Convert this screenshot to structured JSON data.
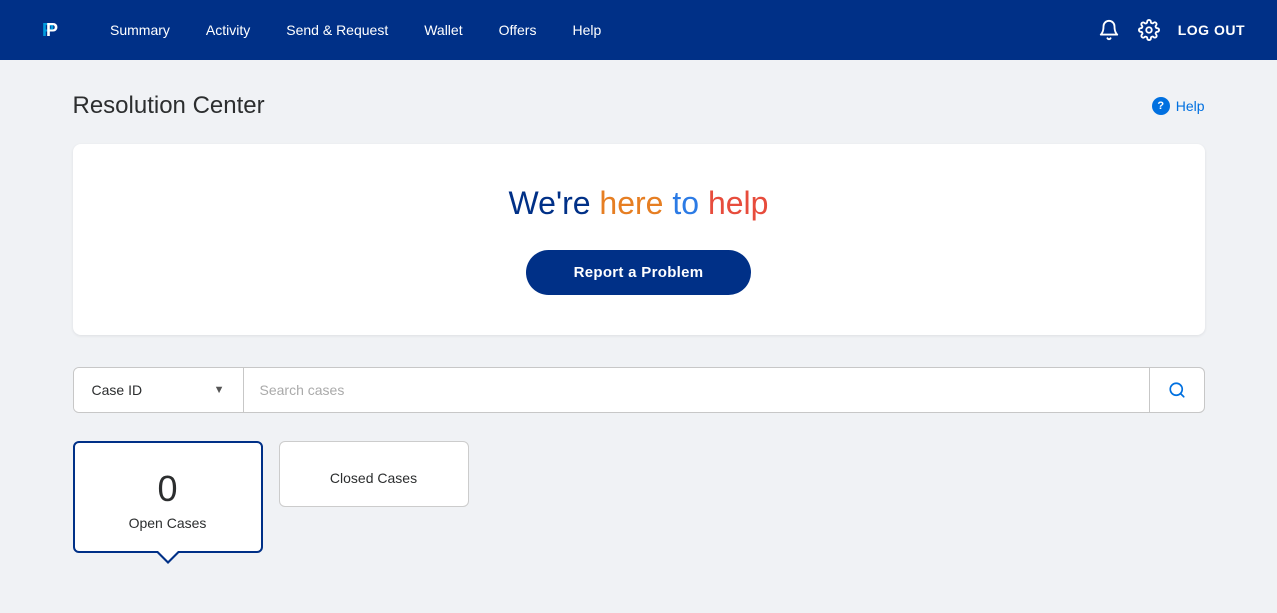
{
  "navbar": {
    "logo_alt": "PayPal",
    "nav_items": [
      {
        "id": "summary",
        "label": "Summary"
      },
      {
        "id": "activity",
        "label": "Activity"
      },
      {
        "id": "send_request",
        "label": "Send & Request"
      },
      {
        "id": "wallet",
        "label": "Wallet"
      },
      {
        "id": "offers",
        "label": "Offers"
      },
      {
        "id": "help",
        "label": "Help"
      }
    ],
    "logout_label": "LOG OUT"
  },
  "page": {
    "title": "Resolution Center",
    "help_link": "Help"
  },
  "hero": {
    "headline_we": "We",
    "headline_re": "'re",
    "headline_here": "here",
    "headline_to": " to ",
    "headline_help": "help",
    "report_btn": "Report a Problem"
  },
  "search": {
    "filter_label": "Case ID",
    "placeholder": "Search cases"
  },
  "tabs": [
    {
      "id": "open",
      "count": "0",
      "label": "Open Cases",
      "active": true
    },
    {
      "id": "closed",
      "count": "",
      "label": "Closed Cases",
      "active": false
    }
  ]
}
